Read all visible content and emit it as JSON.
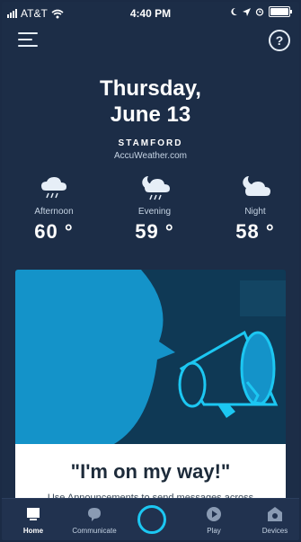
{
  "status": {
    "carrier": "AT&T",
    "time": "4:40 PM"
  },
  "header": {
    "menu_icon": "hamburger-menu-icon",
    "help_icon": "help-circle-icon",
    "help_glyph": "?"
  },
  "date": {
    "weekday": "Thursday,",
    "day": "June 13"
  },
  "location": {
    "city": "STAMFORD",
    "source": "AccuWeather.com"
  },
  "forecast": [
    {
      "period": "Afternoon",
      "temp": "60 °",
      "icon": "rain-cloud-icon"
    },
    {
      "period": "Evening",
      "temp": "59 °",
      "icon": "moon-cloud-rain-icon"
    },
    {
      "period": "Night",
      "temp": "58 °",
      "icon": "moon-cloud-icon"
    }
  ],
  "card": {
    "title": "\"I'm on my way!\"",
    "subtitle": "Use Announcements to send messages across",
    "art_icon": "megaphone-icon"
  },
  "nav": {
    "home": "Home",
    "communicate": "Communicate",
    "play": "Play",
    "devices": "Devices"
  },
  "colors": {
    "accent": "#1cc7f2",
    "background": "#1c2d47",
    "card_art": "#1493c9"
  }
}
